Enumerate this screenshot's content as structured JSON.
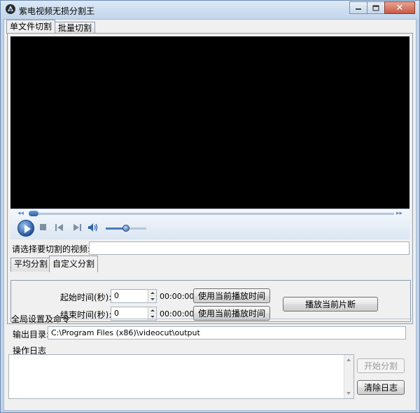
{
  "window": {
    "title": "紫电视频无损分割王"
  },
  "tabs": {
    "single": "单文件切割",
    "batch": "批量切割"
  },
  "player": {},
  "file_select": {
    "label": "请选择要切割的视频:",
    "value": ""
  },
  "split_tabs": {
    "average": "平均分割",
    "custom": "自定义分割"
  },
  "custom": {
    "start_label": "起始时间(秒):",
    "start_value": "0",
    "start_time": "00:00:00",
    "end_label": "结束时间(秒):",
    "end_value": "0",
    "end_time": "00:00:00",
    "use_current_time": "使用当前播放时间",
    "play_segment": "播放当前片断"
  },
  "global": {
    "title": "全局设置及命令",
    "output_label": "输出目录:",
    "output_value": "C:\\Program Files (x86)\\videocut\\output",
    "log_label": "操作日志",
    "start_split": "开始分割",
    "clear_log": "清除日志"
  }
}
